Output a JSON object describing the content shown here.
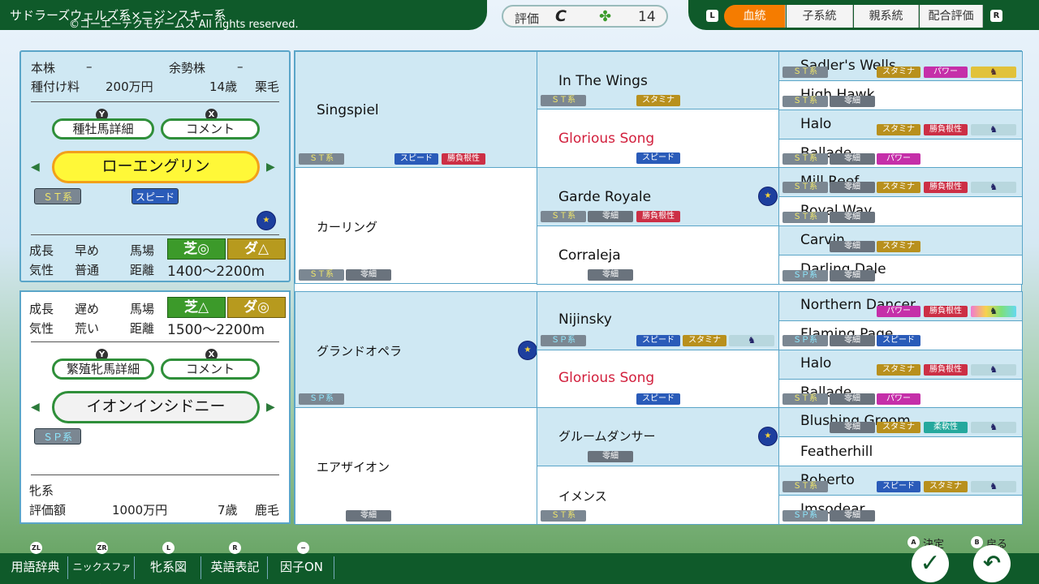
{
  "header": {
    "title": "サドラーズウェルズ系×ニジンスキー系",
    "copyright": "©コーエーテクモゲームス All rights reserved.",
    "eval_label": "評価",
    "eval_grade": "C",
    "clover_icon": "four-leaf-clover",
    "eval_count": "14",
    "tabs": [
      "血統",
      "子系統",
      "親系統",
      "配合評価"
    ],
    "tab_l": "L",
    "tab_r": "R"
  },
  "stallion": {
    "honkabu": "本株",
    "honkabu_val": "–",
    "yoseikabu": "余勢株",
    "yoseikabu_val": "–",
    "fee_label": "種付け料",
    "fee": "200万円",
    "age": "14歳",
    "color": "栗毛",
    "detail_btn": "種牡馬詳細",
    "comment_btn": "コメント",
    "y": "Y",
    "x": "X",
    "name": "ローエングリン",
    "line_tag": "ＳＴ系",
    "factor_tag": "スピード",
    "growth_label": "成長",
    "growth": "早め",
    "track_label": "馬場",
    "turf": "芝◎",
    "dirt": "ダ△",
    "temper_label": "気性",
    "temper": "普通",
    "dist_label": "距離",
    "distance": "1400～2200m"
  },
  "mare": {
    "growth_label": "成長",
    "growth": "遅め",
    "track_label": "馬場",
    "turf": "芝△",
    "dirt": "ダ◎",
    "temper_label": "気性",
    "temper": "荒い",
    "dist_label": "距離",
    "distance": "1500～2200m",
    "detail_btn": "繁殖牝馬詳細",
    "comment_btn": "コメント",
    "y": "Y",
    "x": "X",
    "name": "イオンインシドニー",
    "line_tag": "ＳＰ系",
    "line_label": "牝系",
    "value_label": "評価額",
    "value": "1000万円",
    "age": "7歳",
    "color": "鹿毛"
  },
  "pedigree": {
    "g1": [
      "Singspiel",
      "カーリング",
      "グランドオペラ",
      "エアザイオン"
    ],
    "g2": [
      "In The Wings",
      "Glorious Song",
      "Garde Royale",
      "Corraleja",
      "Nijinsky",
      "Glorious Song",
      "グルームダンサー",
      "イメンス"
    ],
    "g3": [
      "Sadler's Wells",
      "High Hawk",
      "Halo",
      "Ballade",
      "Mill Reef",
      "Royal Way",
      "Carvin",
      "Darling Dale",
      "Northern Dancer",
      "Flaming Page",
      "Halo",
      "Ballade",
      "Blushing Groom",
      "Featherhill",
      "Roberto",
      "Imsodear"
    ],
    "tags": {
      "st": "ＳＴ系",
      "sp": "ＳＰ系",
      "speed": "スピード",
      "stamina": "スタミナ",
      "guts": "勝負根性",
      "power": "パワー",
      "soft": "柔軟性",
      "hidden": "零細"
    }
  },
  "footer": {
    "buttons": [
      "用語辞典",
      "ニックスファイル",
      "牝系図",
      "英語表記",
      "因子ON"
    ],
    "keys": [
      "ZL",
      "ZR",
      "L",
      "R",
      "−"
    ],
    "confirm": "決定",
    "back": "戻る",
    "a": "A",
    "b": "B"
  }
}
